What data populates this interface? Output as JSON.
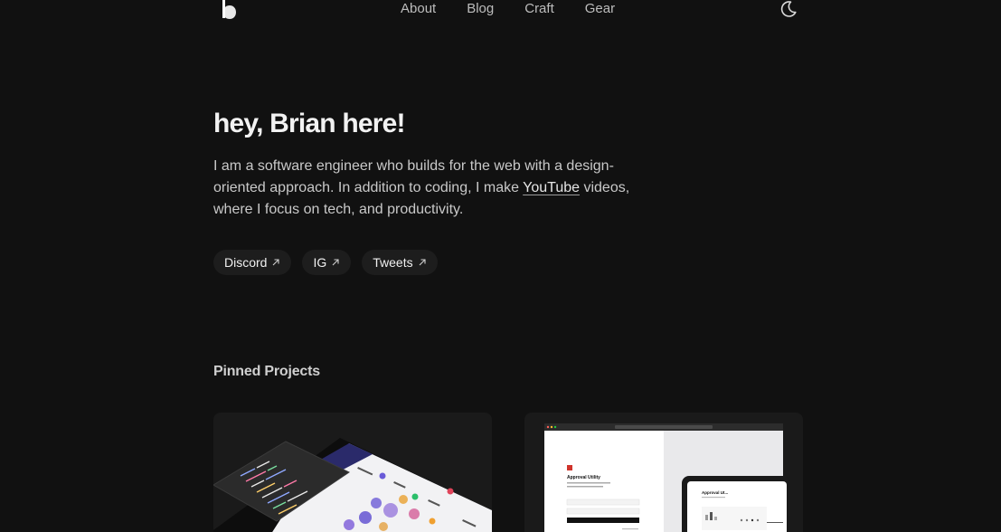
{
  "nav": {
    "items": [
      {
        "label": "About"
      },
      {
        "label": "Blog"
      },
      {
        "label": "Craft"
      },
      {
        "label": "Gear"
      }
    ]
  },
  "hero": {
    "title": "hey, Brian here!",
    "bio_part1": "I am a software engineer who builds for the web with a design-oriented approach. In addition to coding, I make ",
    "bio_link": "YouTube",
    "bio_part2": " videos, where I focus on tech, and productivity."
  },
  "socials": [
    {
      "label": "Discord"
    },
    {
      "label": "IG"
    },
    {
      "label": "Tweets"
    }
  ],
  "pinned": {
    "title": "Pinned Projects",
    "card2_screen_title": "Approval Utility",
    "card2_preview_title": "Approval Ut..."
  },
  "colors": {
    "background": "#111111",
    "pill": "#1d1d1d",
    "card": "#1a1a1a"
  }
}
